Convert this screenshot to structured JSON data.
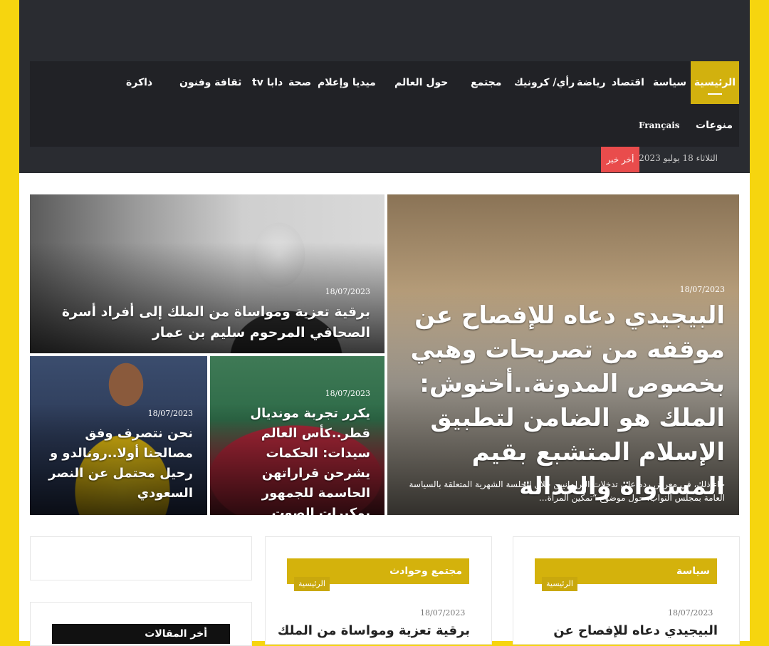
{
  "nav": {
    "row1": [
      "الرئيسية",
      "سياسة",
      "اقتصاد",
      "رياضة",
      "رأي/ كرونيك",
      "مجتمع",
      "حول العالم",
      "ميديا وإعلام",
      "صحة",
      "دابا tv",
      "ثقافة وفنون",
      "ذاكرة"
    ],
    "row2": [
      "منوعات",
      "Français"
    ]
  },
  "ticker": {
    "date": "الثلاثاء 18 يوليو 2023",
    "breaking_label": "أخر خبر"
  },
  "featured": {
    "main": {
      "date": "18/07/2023",
      "title": "البيجيدي دعاه للإفصاح عن موقفه من تصريحات وهبي بخصوص المدونة..أخنوش: الملك هو الضامن لتطبيق الإسلام المتشبع بقيم المساواة والعدالة",
      "excerpt": "جاء ذلك، في معرض رده على تدخلات البرلمانيين خلال الجلسة الشهرية المتعلقة بالسياسة العامة بمجلس النواب، حول موضوع “تمكين المرأة…"
    },
    "top_left": {
      "date": "18/07/2023",
      "title": "برقية تعزية ومواساة من الملك إلى أفراد أسرة الصحافي المرحوم سليم بن عمار"
    },
    "bottom_mid": {
      "date": "18/07/2023",
      "title": "يكرر تجربة مونديال قطر..كأس العالم سيدات: الحكمات يشرحن قراراتهن الحاسمة للجمهور بمكبرات الصوت"
    },
    "bottom_left": {
      "date": "18/07/2023",
      "title": "نحن نتصرف وفق مصالحنا أولا..رونالدو و رحيل محتمل عن النصر السعودي"
    }
  },
  "sections": {
    "politics": {
      "label": "سياسة",
      "tag": "الرئيسية",
      "date": "18/07/2023",
      "title": "البيجيدي دعاه للإفصاح عن"
    },
    "society": {
      "label": "مجتمع وحوادث",
      "tag": "الرئيسية",
      "date": "18/07/2023",
      "title": "برقية تعزية ومواساة من الملك"
    }
  },
  "sidebar": {
    "latest_label": "أخر المقالات"
  },
  "colors": {
    "background": "#f6d50f",
    "header": "#2a2c31",
    "accent": "#d2b10e",
    "breaking": "#e94c4c"
  }
}
